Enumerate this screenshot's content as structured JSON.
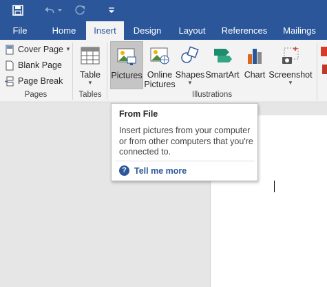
{
  "quick_access": {
    "save_icon": "save-icon",
    "undo_icon": "undo-icon",
    "redo_icon": "redo-icon",
    "customize_icon": "customize-quick-access-icon"
  },
  "tabs": [
    {
      "label": "File"
    },
    {
      "label": "Home"
    },
    {
      "label": "Insert"
    },
    {
      "label": "Design"
    },
    {
      "label": "Layout"
    },
    {
      "label": "References"
    },
    {
      "label": "Mailings"
    }
  ],
  "active_tab": "Insert",
  "ribbon": {
    "pages": {
      "cover_page": "Cover Page",
      "blank_page": "Blank Page",
      "page_break": "Page Break",
      "group_label": "Pages"
    },
    "tables": {
      "table": "Table",
      "group_label": "Tables"
    },
    "illustrations": {
      "pictures": "Pictures",
      "online_pictures_line1": "Online",
      "online_pictures_line2": "Pictures",
      "shapes": "Shapes",
      "smartart": "SmartArt",
      "chart": "Chart",
      "screenshot": "Screenshot",
      "group_label": "Illustrations"
    }
  },
  "tooltip": {
    "title": "From File",
    "body": "Insert pictures from your computer or from other computers that you're connected to.",
    "tell_me_more": "Tell me more"
  },
  "colors": {
    "brand": "#2b579a",
    "ribbon": "#f3f3f3"
  }
}
